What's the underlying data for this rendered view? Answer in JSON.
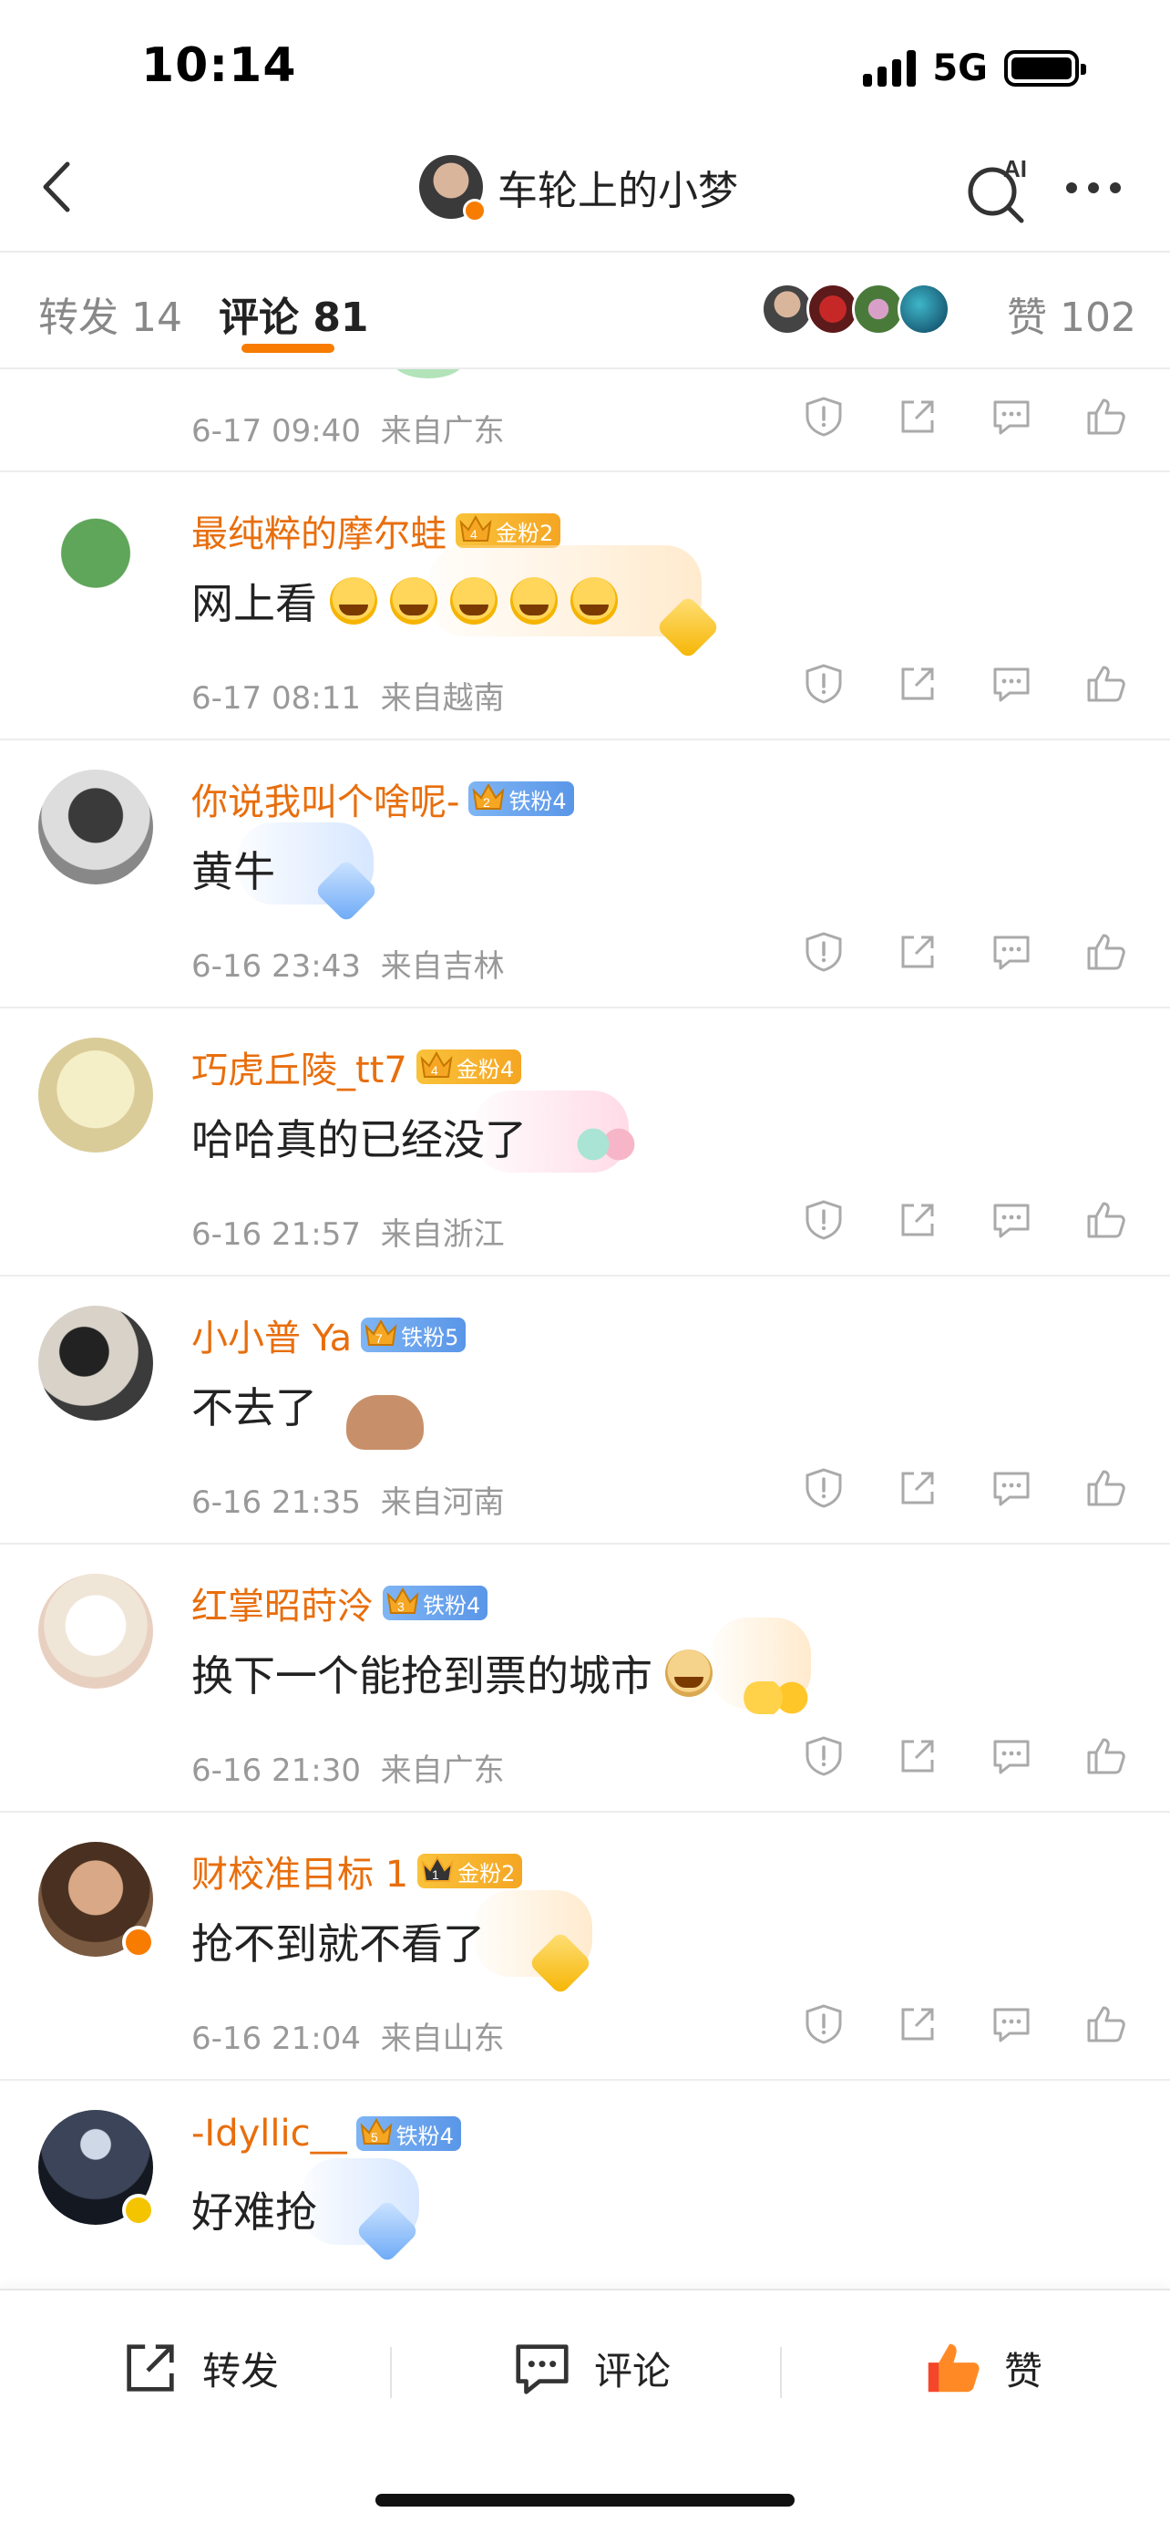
{
  "status_bar": {
    "time": "10:14",
    "network": "5G"
  },
  "nav": {
    "title": "车轮上的小梦",
    "ai_label": "AI"
  },
  "tabs": {
    "repost": "转发 14",
    "comment": "评论 81",
    "likes": "赞 102"
  },
  "top_partial": {
    "time": "6-17 09:40",
    "location": "来自广东"
  },
  "comments": [
    {
      "user": "最纯粹的摩尔蛙",
      "badge": "金粉2",
      "badge_level": "4",
      "badge_type": "gold",
      "text": "网上看",
      "emoji_count": 5,
      "time": "6-17 08:11",
      "location": "来自越南"
    },
    {
      "user": "你说我叫个啥呢-",
      "badge": "铁粉4",
      "badge_level": "2",
      "badge_type": "iron",
      "text": "黄牛",
      "time": "6-16 23:43",
      "location": "来自吉林"
    },
    {
      "user": "巧虎丘陵_tt7",
      "badge": "金粉4",
      "badge_level": "4",
      "badge_type": "gold",
      "text": "哈哈真的已经没了",
      "time": "6-16 21:57",
      "location": "来自浙江"
    },
    {
      "user": "小小普 Ya",
      "badge": "铁粉5",
      "badge_level": "7",
      "badge_type": "iron",
      "text": "不去了",
      "time": "6-16 21:35",
      "location": "来自河南"
    },
    {
      "user": "红掌昭莳泠",
      "badge": "铁粉4",
      "badge_level": "3",
      "badge_type": "iron",
      "text": "换下一个能抢到票的城市",
      "time": "6-16 21:30",
      "location": "来自广东"
    },
    {
      "user": "财校准目标 1",
      "badge": "金粉2",
      "badge_level": "1",
      "badge_type": "gold",
      "text": "抢不到就不看了",
      "time": "6-16 21:04",
      "location": "来自山东"
    },
    {
      "user": "-Idyllic__",
      "badge": "铁粉4",
      "badge_level": "5",
      "badge_type": "iron",
      "text": "好难抢",
      "time": "",
      "location": ""
    }
  ],
  "bottom_bar": {
    "repost": "转发",
    "comment": "评论",
    "like": "赞"
  },
  "colors": {
    "accent": "#f77c00",
    "username": "#e86e0c",
    "meta": "#999999"
  }
}
